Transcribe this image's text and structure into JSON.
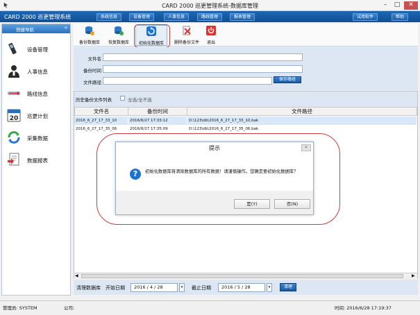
{
  "window": {
    "title": "CARD 2000 巡更管理系统-数据库管理"
  },
  "menubar": {
    "app_name": "CARD 2000 巡更管理系统",
    "items": [
      "系统信息",
      "设备管理",
      "人事信息",
      "路线管理",
      "报表管理"
    ],
    "right_items": [
      "试用软件",
      "帮助"
    ]
  },
  "sidebar": {
    "header": "快捷导航",
    "items": [
      {
        "label": "设备管理",
        "icon": "phone-icon"
      },
      {
        "label": "人事信息",
        "icon": "person-icon"
      },
      {
        "label": "路线信息",
        "icon": "route-icon"
      },
      {
        "label": "巡更计划",
        "icon": "calendar-icon"
      },
      {
        "label": "采集数据",
        "icon": "sync-icon"
      },
      {
        "label": "数据报表",
        "icon": "report-icon"
      }
    ]
  },
  "toolbar": {
    "buttons": [
      {
        "label": "备份数据库",
        "icon": "db-backup-icon"
      },
      {
        "label": "恢复数据库",
        "icon": "db-restore-icon"
      },
      {
        "label": "初始化数据库",
        "icon": "db-init-icon"
      },
      {
        "label": "删除备份文件",
        "icon": "delete-file-icon"
      },
      {
        "label": "退出",
        "icon": "power-icon"
      }
    ]
  },
  "form": {
    "file_name_label": "文件名",
    "backup_time_label": "备份时间",
    "file_path_label": "文件路径",
    "browse_label": "保存路径"
  },
  "history": {
    "caption": "历史备份文件列表",
    "select_all_label": "全选/全不选",
    "columns": [
      "文件名",
      "备份时间",
      "文件路径"
    ],
    "rows": [
      {
        "name": "2016_6_27_17_33_10",
        "time": "2016/6/27 17:33:12",
        "path": "D:\\123\\db\\2016_6_27_17_33_10.bak"
      },
      {
        "name": "2016_6_27_17_35_06",
        "time": "2016/6/27 17:35:09",
        "path": "D:\\123\\db\\2016_6_27_17_35_06.bak"
      }
    ]
  },
  "filter": {
    "clear_label": "清理数据库",
    "start_label": "开始日期",
    "start_value": "2016 / 4 / 28",
    "end_label": "截止日期",
    "end_value": "2016 / 5 / 28",
    "button_label": "清理"
  },
  "status": {
    "operator": "管理员: SYSTEM",
    "company": "公司:",
    "time": "时间: 2016/6/28 17:19:37"
  },
  "dialog": {
    "title": "提示",
    "message": "初始化数据库将清除数据库的所有数据！请谨慎操作。您确定要初始化数据库？",
    "yes": "是(Y)",
    "no": "否(N)"
  },
  "colors": {
    "accent": "#1a5aa5",
    "highlight": "#d23b3b"
  }
}
